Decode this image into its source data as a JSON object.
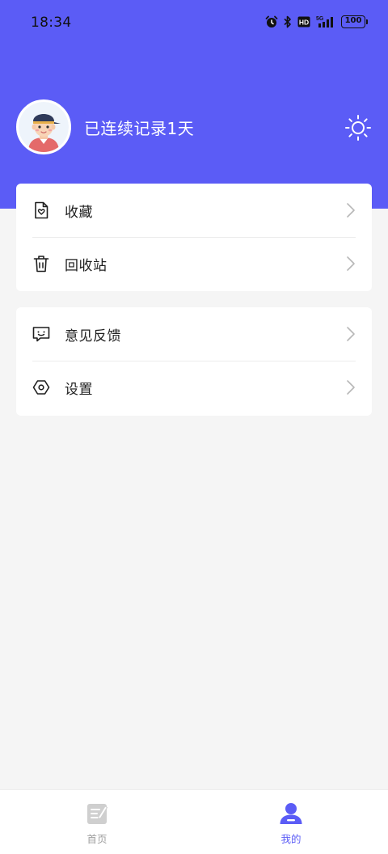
{
  "status_bar": {
    "time": "18:34",
    "battery": "100",
    "network": "5G",
    "icons": [
      "alarm-icon",
      "bluetooth-icon",
      "hd-icon",
      "signal-icon",
      "battery-icon"
    ]
  },
  "profile": {
    "avatar": "avatar",
    "streak_text": "已连续记录1天",
    "theme_icon": "sun-icon"
  },
  "menu": {
    "group1": [
      {
        "label": "收藏",
        "icon": "favorite-doc-icon"
      },
      {
        "label": "回收站",
        "icon": "trash-icon"
      }
    ],
    "group2": [
      {
        "label": "意见反馈",
        "icon": "feedback-icon"
      },
      {
        "label": "设置",
        "icon": "settings-icon"
      }
    ]
  },
  "tabbar": {
    "tabs": [
      {
        "label": "首页",
        "icon": "note-icon",
        "active": false
      },
      {
        "label": "我的",
        "icon": "user-icon",
        "active": true
      }
    ]
  },
  "colors": {
    "accent": "#5b5cf6",
    "background": "#f5f5f5",
    "card": "#ffffff",
    "inactive": "#a0a0a0"
  }
}
